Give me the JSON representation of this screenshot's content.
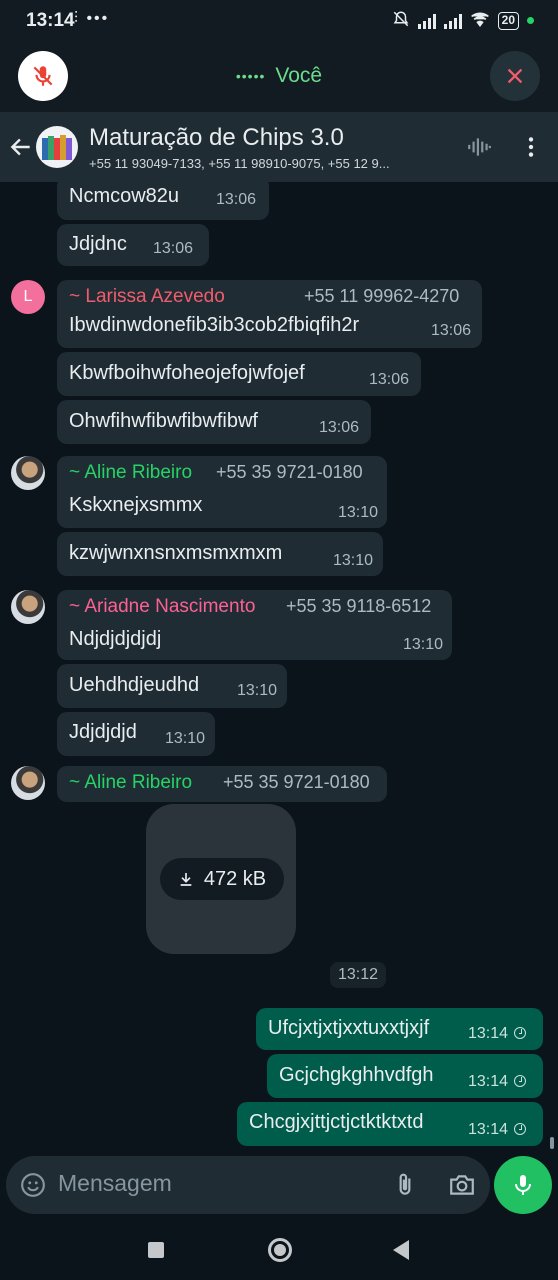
{
  "status_bar": {
    "time": "13:14",
    "left_icons": "⫶ •••",
    "battery": "20"
  },
  "call": {
    "title": "Você",
    "dots": "•••••"
  },
  "header": {
    "group_name": "Maturação de Chips 3.0",
    "participants": "+55 11 93049-7133, +55 11 98910-9075, +55 12 9..."
  },
  "messages": {
    "m1": {
      "text": "Ncmcow82u",
      "time": "13:06"
    },
    "m2": {
      "text": "Jdjdnc",
      "time": "13:06"
    },
    "larissa": {
      "avatar_letter": "L",
      "sender": "~ Larissa Azevedo",
      "phone": "+55 11 99962-4270",
      "text": "Ibwdinwdonefib3ib3cob2fbiqfih2r",
      "time": "13:06"
    },
    "m4": {
      "text": "Kbwfboihwfoheojefojwfojef",
      "time": "13:06"
    },
    "m5": {
      "text": "Ohwfihwfibwfibwfibwf",
      "time": "13:06"
    },
    "aline1": {
      "sender": "~ Aline Ribeiro",
      "phone": "+55 35 9721-0180",
      "text": "Kskxnejxsmmx",
      "time": "13:10"
    },
    "m7": {
      "text": "kzwjwnxnsnxmsmxmxm",
      "time": "13:10"
    },
    "ariadne": {
      "sender": "~ Ariadne Nascimento",
      "phone": "+55 35 9118-6512",
      "text": "Ndjdjdjdjdj",
      "time": "13:10"
    },
    "m9": {
      "text": "Uehdhdjeudhd",
      "time": "13:10"
    },
    "m10": {
      "text": "Jdjdjdjd",
      "time": "13:10"
    },
    "aline2": {
      "sender": "~ Aline Ribeiro",
      "phone": "+55 35 9721-0180"
    },
    "media": {
      "size": "472 kB"
    },
    "date_chip": "13:12",
    "out1": {
      "text": "Ufcjxtjxtjxxtuxxtjxjf",
      "time": "13:14"
    },
    "out2": {
      "text": "Gcjchgkghhvdfgh",
      "time": "13:14"
    },
    "out3": {
      "text": "Chcgjxjttjctjctktktxtd",
      "time": "13:14"
    }
  },
  "composer": {
    "placeholder": "Mensagem"
  },
  "colors": {
    "background": "#0b141a",
    "incoming_bubble": "#202c33",
    "outgoing_bubble": "#005c4b",
    "larissa_name": "#f15c6d",
    "aline_name": "#25d366",
    "ariadne_name": "#fc6193",
    "call_title": "#6ddb8c",
    "mic_button": "#21c063"
  }
}
